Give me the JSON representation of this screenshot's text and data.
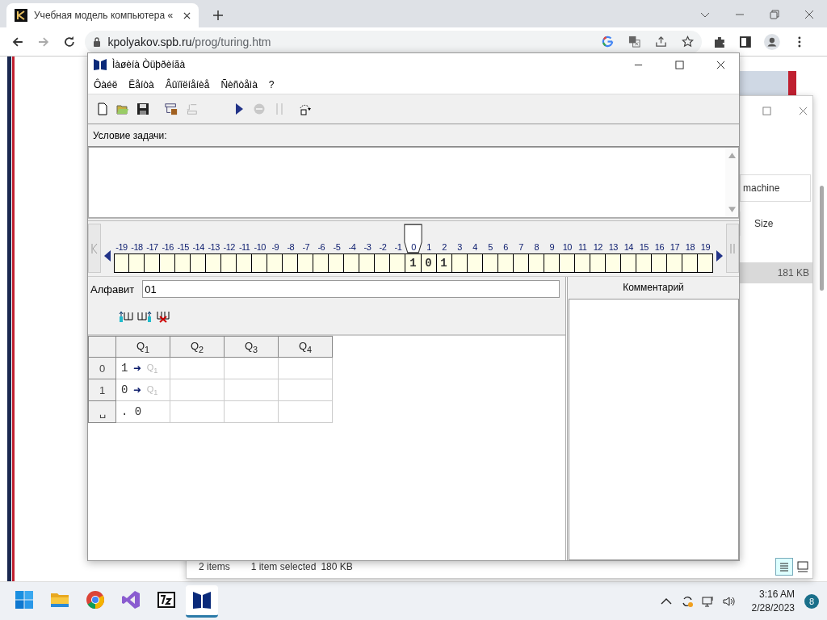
{
  "browser": {
    "tab_title": "Учебная модель компьютера «",
    "url_host": "kpolyakov.spb.ru",
    "url_path": "/prog/turing.htm"
  },
  "explorer": {
    "search_value": "machine",
    "column": "Size",
    "row_size": "181 KB",
    "status_items": "2 items",
    "status_selected": "1 item selected",
    "status_size": "180 KB"
  },
  "app": {
    "title": "Ìàøèíà Òüþðèíãà",
    "menu": [
      "Ôàéë",
      "Ëåíòà",
      "Âûïîëíåíèå",
      "Ñèñòåìà",
      "?"
    ],
    "toolbar": [
      {
        "kind": "new",
        "disabled": false
      },
      {
        "kind": "open",
        "disabled": false
      },
      {
        "kind": "save",
        "disabled": false
      },
      {
        "kind": "tape-load",
        "disabled": false
      },
      {
        "kind": "tape-save",
        "disabled": true
      },
      {
        "kind": "run",
        "disabled": false
      },
      {
        "kind": "stop",
        "disabled": true
      },
      {
        "kind": "pause",
        "disabled": true
      },
      {
        "kind": "step",
        "disabled": false
      }
    ],
    "problem_label": "Условие задачи:",
    "tape": [
      {
        "label": "-19",
        "head": false
      },
      {
        "label": "-18",
        "head": false
      },
      {
        "label": "-17",
        "head": false
      },
      {
        "label": "-16",
        "head": false
      },
      {
        "label": "-15",
        "head": false
      },
      {
        "label": "-14",
        "head": false
      },
      {
        "label": "-13",
        "head": false
      },
      {
        "label": "-12",
        "head": false
      },
      {
        "label": "-11",
        "head": false
      },
      {
        "label": "-10",
        "head": false
      },
      {
        "label": "-9",
        "head": false
      },
      {
        "label": "-8",
        "head": false
      },
      {
        "label": "-7",
        "head": false
      },
      {
        "label": "-6",
        "head": false
      },
      {
        "label": "-5",
        "head": false
      },
      {
        "label": "-4",
        "head": false
      },
      {
        "label": "-3",
        "head": false
      },
      {
        "label": "-2",
        "head": false
      },
      {
        "label": "-1",
        "head": false
      },
      {
        "label": "0",
        "head": true,
        "symbol": "1"
      },
      {
        "label": "1",
        "head": false,
        "symbol": "0"
      },
      {
        "label": "2",
        "head": false,
        "symbol": "1"
      },
      {
        "label": "3",
        "head": false
      },
      {
        "label": "4",
        "head": false
      },
      {
        "label": "5",
        "head": false
      },
      {
        "label": "6",
        "head": false
      },
      {
        "label": "7",
        "head": false
      },
      {
        "label": "8",
        "head": false
      },
      {
        "label": "9",
        "head": false
      },
      {
        "label": "10",
        "head": false
      },
      {
        "label": "11",
        "head": false
      },
      {
        "label": "12",
        "head": false
      },
      {
        "label": "13",
        "head": false
      },
      {
        "label": "14",
        "head": false
      },
      {
        "label": "15",
        "head": false
      },
      {
        "label": "16",
        "head": false
      },
      {
        "label": "17",
        "head": false
      },
      {
        "label": "18",
        "head": false
      },
      {
        "label": "19",
        "head": false
      }
    ],
    "alphabet_label": "Алфавит",
    "alphabet_value": "01",
    "alphabet_tools": [
      {
        "kind": "insert-before"
      },
      {
        "kind": "insert-after"
      },
      {
        "kind": "delete"
      }
    ],
    "columns": [
      "Q$_{1}$",
      "Q$_{2}$",
      "Q$_{3}$",
      "Q$_{4}$"
    ],
    "rows": [
      {
        "symbol": "0",
        "cells": [
          {
            "write": "1",
            "arrow": "➜",
            "state": "Q$_{1}$"
          },
          {},
          {},
          {}
        ]
      },
      {
        "symbol": "1",
        "cells": [
          {
            "write": "0",
            "arrow": "➜",
            "state": "Q$_{1}$"
          },
          {},
          {},
          {}
        ]
      },
      {
        "symbol": "␣",
        "cells": [
          {
            "write": ". 0"
          },
          {},
          {},
          {}
        ]
      }
    ],
    "comment_header": "Комментарий"
  },
  "taskbar": {
    "apps": [
      {
        "kind": "start",
        "selected": false
      },
      {
        "kind": "folder",
        "selected": false
      },
      {
        "kind": "chrome",
        "selected": false
      },
      {
        "kind": "studio",
        "selected": false
      },
      {
        "kind": "archiver",
        "selected": false
      },
      {
        "kind": "turing",
        "selected": true
      }
    ],
    "time": "3:16 AM",
    "date": "2/28/2023",
    "badge": "8"
  }
}
